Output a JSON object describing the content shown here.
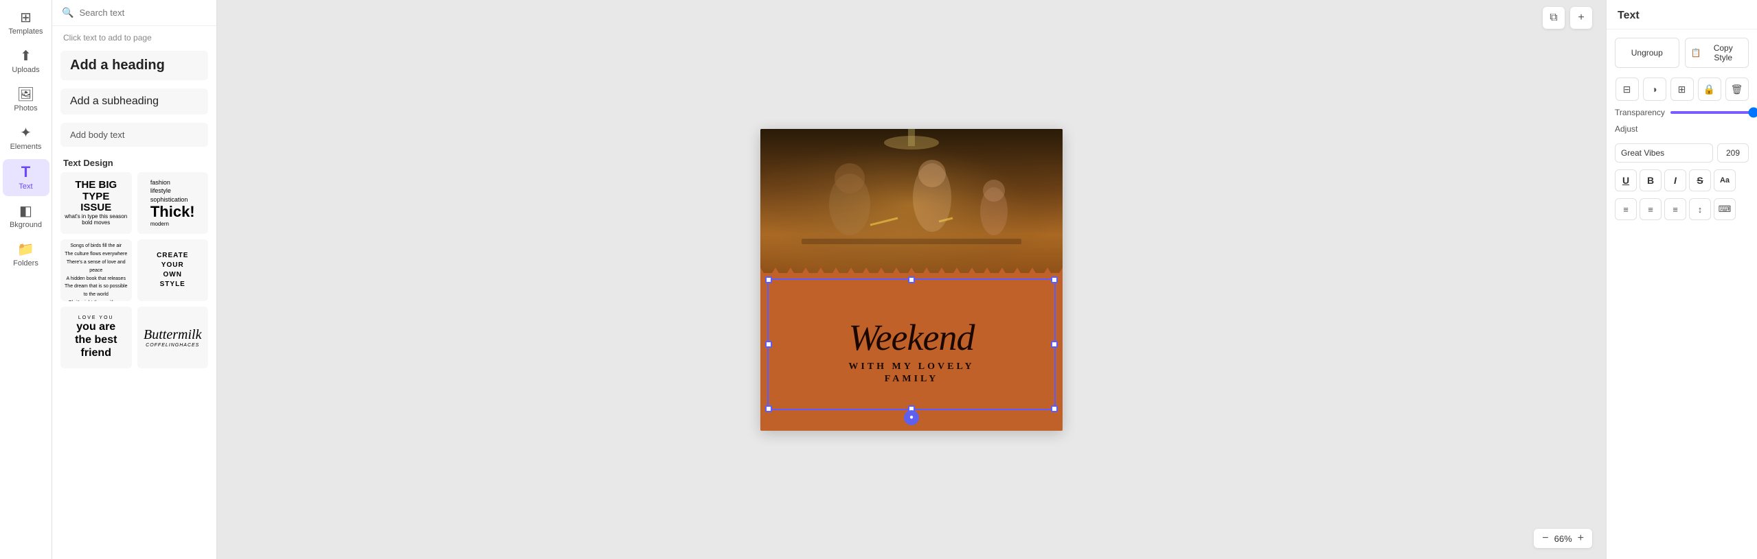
{
  "sidebar": {
    "items": [
      {
        "id": "templates",
        "label": "Templates",
        "icon": "⊞"
      },
      {
        "id": "uploads",
        "label": "Uploads",
        "icon": "⬆"
      },
      {
        "id": "photos",
        "label": "Photos",
        "icon": "🖼"
      },
      {
        "id": "elements",
        "label": "Elements",
        "icon": "✦"
      },
      {
        "id": "text",
        "label": "Text",
        "icon": "T",
        "active": true
      },
      {
        "id": "background",
        "label": "Bkground",
        "icon": "◧"
      },
      {
        "id": "folders",
        "label": "Folders",
        "icon": "📁"
      }
    ]
  },
  "panel": {
    "search_placeholder": "Search text",
    "click_hint": "Click text to add to page",
    "add_heading": "Add a heading",
    "add_subheading": "Add a subheading",
    "add_body": "Add body text",
    "section_label": "Text Design",
    "designs": [
      {
        "id": "big-type",
        "type": "big-type"
      },
      {
        "id": "fashion",
        "type": "fashion"
      },
      {
        "id": "flight",
        "type": "flight"
      },
      {
        "id": "create",
        "type": "create"
      },
      {
        "id": "love",
        "type": "love"
      },
      {
        "id": "buttermilk",
        "type": "buttermilk"
      }
    ]
  },
  "canvas": {
    "main_text": "Weekend",
    "sub_text": "WITH MY LOVELY",
    "sub_text2": "FAMILY",
    "zoom": "66%",
    "zoom_minus": "−",
    "zoom_plus": "+"
  },
  "right_panel": {
    "title": "Text",
    "ungroup_label": "Ungroup",
    "copy_style_label": "Copy Style",
    "transparency_label": "Transparency",
    "transparency_value": "100",
    "adjust_label": "Adjust",
    "font_name": "Great Vibes",
    "font_size": "209",
    "format_buttons": [
      {
        "id": "underline",
        "label": "U"
      },
      {
        "id": "bold",
        "label": "B"
      },
      {
        "id": "italic",
        "label": "I"
      },
      {
        "id": "strikethrough",
        "label": "S"
      },
      {
        "id": "case",
        "label": "Aa"
      }
    ],
    "align_buttons": [
      {
        "id": "align-left",
        "symbol": "≡"
      },
      {
        "id": "align-center",
        "symbol": "≡"
      },
      {
        "id": "align-right",
        "symbol": "≡"
      },
      {
        "id": "line-height",
        "symbol": "↕"
      },
      {
        "id": "more",
        "symbol": "⌨"
      }
    ]
  }
}
